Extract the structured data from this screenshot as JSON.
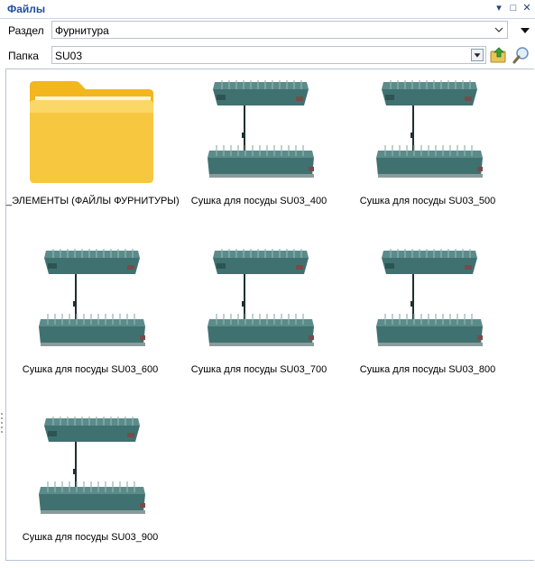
{
  "window": {
    "title": "Файлы",
    "controls": [
      "▾",
      "□",
      "✕"
    ]
  },
  "section": {
    "label": "Раздел",
    "value": "Фурнитура"
  },
  "folder": {
    "label": "Папка",
    "value": "SU03"
  },
  "items": [
    {
      "name": "_ЭЛЕМЕНТЫ (ФАЙЛЫ ФУРНИТУРЫ)",
      "kind": "folder"
    },
    {
      "name": "Сушка для посуды SU03_400",
      "kind": "model"
    },
    {
      "name": "Сушка для посуды SU03_500",
      "kind": "model"
    },
    {
      "name": "Сушка для посуды SU03_600",
      "kind": "model"
    },
    {
      "name": "Сушка для посуды SU03_700",
      "kind": "model"
    },
    {
      "name": "Сушка для посуды SU03_800",
      "kind": "model"
    },
    {
      "name": "Сушка для посуды SU03_900",
      "kind": "model"
    }
  ],
  "colors": {
    "title": "#1f4f9f",
    "rack": "#3f7170",
    "folder": "#f6c43a"
  }
}
